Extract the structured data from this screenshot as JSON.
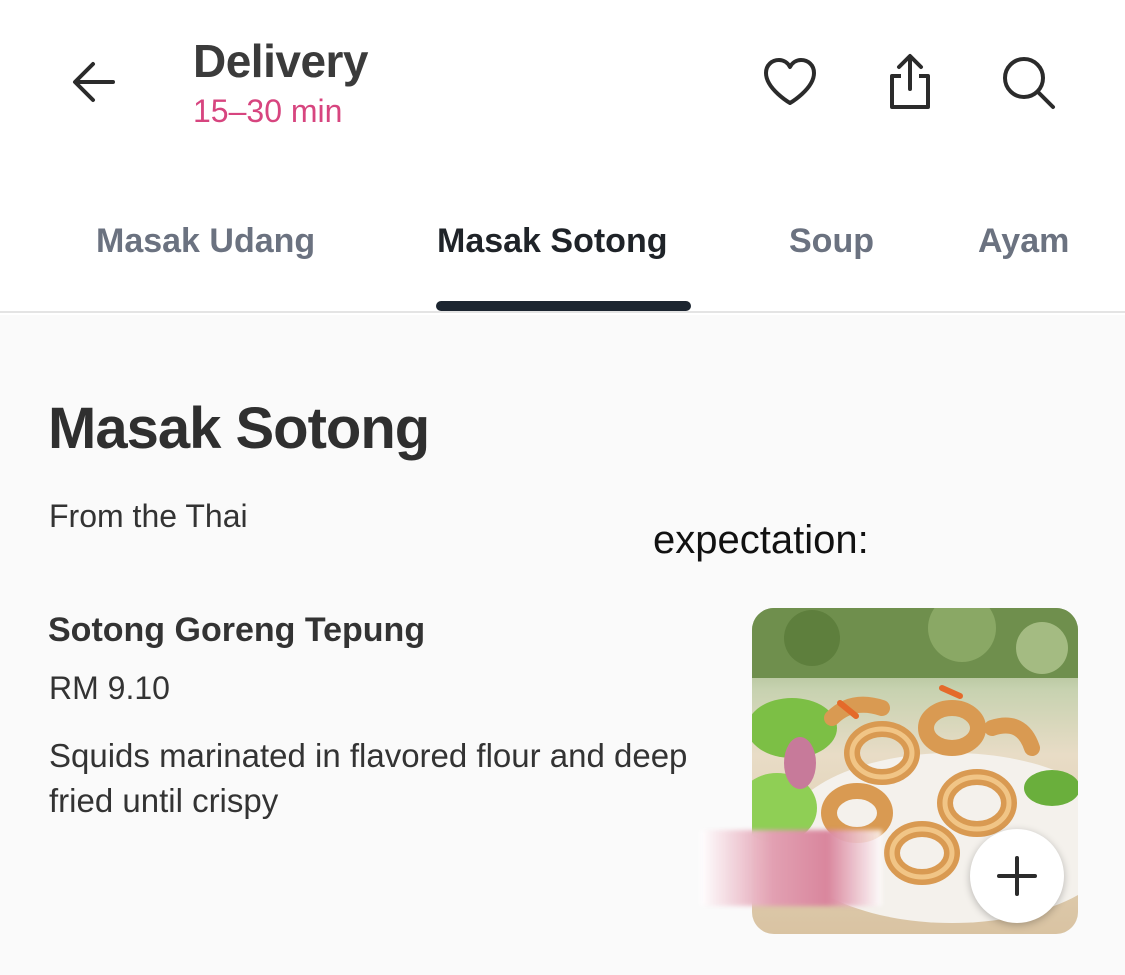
{
  "header": {
    "back_icon": "arrow-left-icon",
    "title": "Delivery",
    "eta": "15–30 min",
    "actions": [
      "heart-icon",
      "share-icon",
      "search-icon"
    ]
  },
  "tabs": [
    {
      "label": "Masak Udang"
    },
    {
      "label": "Masak Sotong",
      "active": true
    },
    {
      "label": "Soup"
    },
    {
      "label": "Ayam"
    }
  ],
  "section": {
    "title": "Masak Sotong",
    "subtitle": "From the Thai"
  },
  "overlay_text": "expectation:",
  "item": {
    "name": "Sotong Goreng Tepung",
    "price": "RM 9.10",
    "description": " Squids marinated in flavored flour and deep fried until crispy",
    "add_icon": "plus-icon"
  },
  "colors": {
    "eta": "#d7457f",
    "active_tab_indicator": "#1c2530",
    "inactive_tab": "#6b7280"
  }
}
